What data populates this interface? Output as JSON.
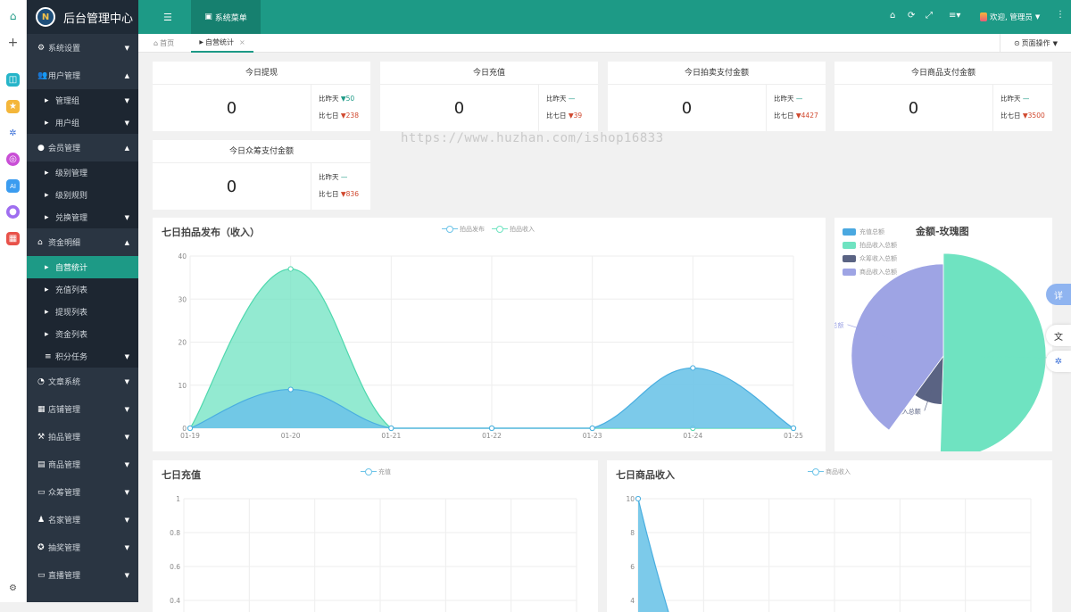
{
  "app": {
    "title": "后台管理中心",
    "logo_letter": "N"
  },
  "sidebar": {
    "items": [
      {
        "label": "系统设置",
        "icon": "gear-icon"
      },
      {
        "label": "用户管理",
        "icon": "users-icon"
      },
      {
        "label": "管理组",
        "icon": "caret-right-icon"
      },
      {
        "label": "用户组",
        "icon": "caret-right-icon"
      },
      {
        "label": "会员管理",
        "icon": "user-circle-icon"
      },
      {
        "label": "级别管理",
        "icon": "caret-right-icon"
      },
      {
        "label": "级别规则",
        "icon": "caret-right-icon"
      },
      {
        "label": "兑换管理",
        "icon": "caret-right-icon"
      },
      {
        "label": "资金明细",
        "icon": "bank-icon"
      },
      {
        "label": "自营统计",
        "icon": "caret-right-icon"
      },
      {
        "label": "充值列表",
        "icon": "caret-right-icon"
      },
      {
        "label": "提现列表",
        "icon": "caret-right-icon"
      },
      {
        "label": "资金列表",
        "icon": "caret-right-icon"
      },
      {
        "label": "积分任务",
        "icon": "list-icon"
      },
      {
        "label": "文章系统",
        "icon": "pie-icon"
      },
      {
        "label": "店铺管理",
        "icon": "grid-icon"
      },
      {
        "label": "拍品管理",
        "icon": "gavel-icon"
      },
      {
        "label": "商品管理",
        "icon": "shop-icon"
      },
      {
        "label": "众筹管理",
        "icon": "money-icon"
      },
      {
        "label": "名家管理",
        "icon": "person-icon"
      },
      {
        "label": "抽奖管理",
        "icon": "prize-icon"
      },
      {
        "label": "直播管理",
        "icon": "monitor-icon"
      }
    ]
  },
  "topbar": {
    "menu_tab": "系统菜单",
    "user": "欢迎, 管理员"
  },
  "tabs": {
    "home": "首页",
    "current": "自营统计",
    "page_ops": "页面操作"
  },
  "stats": [
    {
      "title": "今日提现",
      "value": "0",
      "yday_label": "比昨天",
      "yday": "▼50",
      "week_label": "比七日",
      "week": "▼238"
    },
    {
      "title": "今日充值",
      "value": "0",
      "yday_label": "比昨天",
      "yday": "—",
      "week_label": "比七日",
      "week": "▼39"
    },
    {
      "title": "今日拍卖支付金额",
      "value": "0",
      "yday_label": "比昨天",
      "yday": "—",
      "week_label": "比七日",
      "week": "▼4427"
    },
    {
      "title": "今日商品支付金额",
      "value": "0",
      "yday_label": "比昨天",
      "yday": "—",
      "week_label": "比七日",
      "week": "▼3500"
    },
    {
      "title": "今日众筹支付金额",
      "value": "0",
      "yday_label": "比昨天",
      "yday": "—",
      "week_label": "比七日",
      "week": "▼836"
    }
  ],
  "watermark": "https://www.huzhan.com/ishop16833",
  "colors": {
    "primary": "#1d9a86",
    "sidebar": "#2a3542",
    "series_blue": "#6ec4e8",
    "series_green": "#6fe3c1",
    "purple": "#9aa0e0",
    "dark": "#4a5578"
  },
  "chart_data": [
    {
      "type": "area",
      "title": "七日拍品发布（收入）",
      "categories": [
        "01-19",
        "01-20",
        "01-21",
        "01-22",
        "01-23",
        "01-24",
        "01-25"
      ],
      "series": [
        {
          "name": "拍品发布",
          "values": [
            0,
            9,
            0,
            0,
            0,
            14,
            0
          ]
        },
        {
          "name": "拍品收入",
          "values": [
            0,
            37,
            0,
            0,
            0,
            0,
            0
          ]
        }
      ],
      "ylim": [
        0,
        40
      ],
      "yticks": [
        0,
        10,
        20,
        30,
        40
      ],
      "grid": true,
      "legend": "top-center"
    },
    {
      "type": "pie",
      "title": "金额-玫瑰图",
      "legend": "top-left",
      "slices": [
        {
          "name": "充值总额",
          "value": 0
        },
        {
          "name": "拍品收入总额",
          "value": 4427
        },
        {
          "name": "众筹收入总额",
          "value": 836
        },
        {
          "name": "商品收入总额",
          "value": 3500
        }
      ],
      "slice_labels": [
        "充值总额",
        "拍品收入",
        "众筹收入总额",
        "品收入总额"
      ]
    },
    {
      "type": "line",
      "title": "七日充值",
      "series": [
        {
          "name": "充值",
          "values": []
        }
      ],
      "yticks": [
        "1",
        "0.8",
        "0.6",
        "0.4"
      ],
      "grid": true,
      "legend": "top-center"
    },
    {
      "type": "area",
      "title": "七日商品收入",
      "series": [
        {
          "name": "商品收入",
          "values": [
            10
          ]
        }
      ],
      "yticks": [
        "10",
        "8",
        "6",
        "4"
      ],
      "grid": true,
      "legend": "top-center"
    }
  ]
}
